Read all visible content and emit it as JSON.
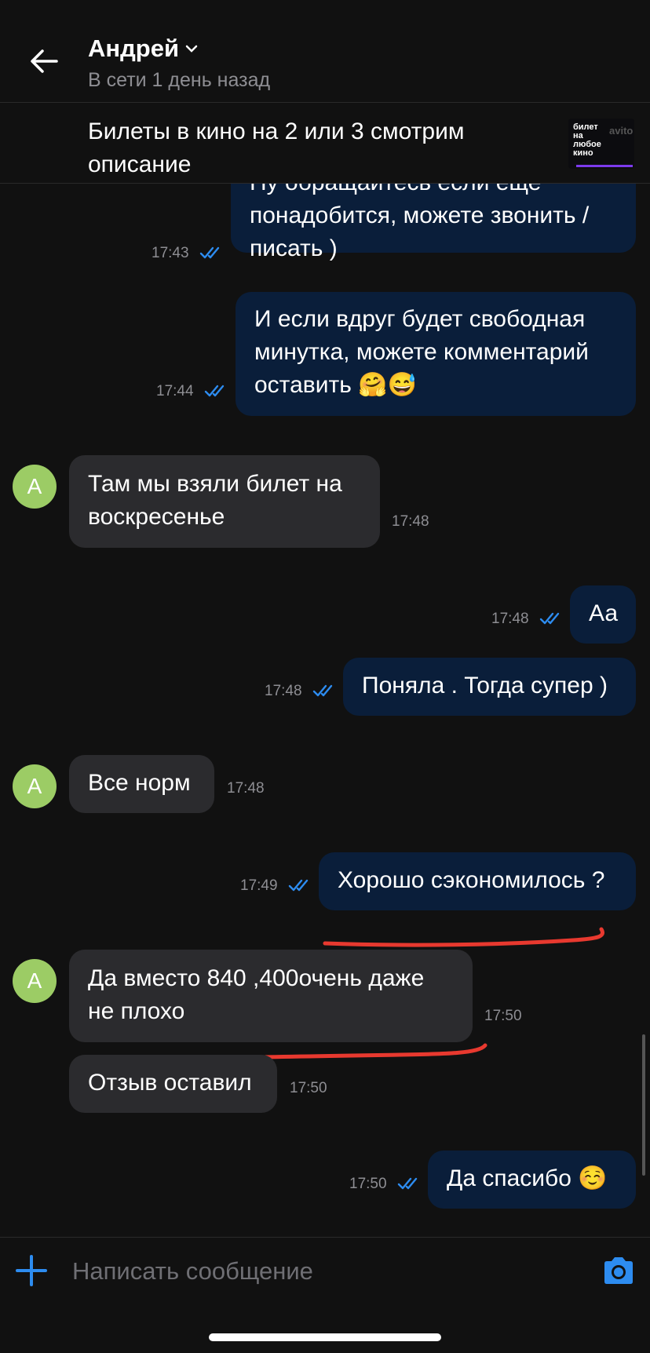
{
  "header": {
    "name": "Андрей",
    "status": "В сети 1 день назад"
  },
  "listing": {
    "title": "Билеты в кино на 2 или 3 смотрим описание",
    "thumb_text": "билет на любое кино",
    "thumb_logo": "avito"
  },
  "messages": [
    {
      "dir": "out",
      "text": "Ну обращайтесь если еще понадобится, можете звонить / писать )",
      "time": "17:43",
      "read": true
    },
    {
      "dir": "out",
      "text": "И если вдруг будет свободная минутка, можете комментарий оставить 🤗😅",
      "time": "17:44",
      "read": true
    },
    {
      "dir": "in",
      "avatar": "А",
      "text": "Там мы взяли билет на воскресенье",
      "time": "17:48"
    },
    {
      "dir": "out",
      "text": "Аа",
      "time": "17:48",
      "read": true
    },
    {
      "dir": "out",
      "text": "Поняла . Тогда супер )",
      "time": "17:48",
      "read": true
    },
    {
      "dir": "in",
      "avatar": "А",
      "text": "Все норм",
      "time": "17:48"
    },
    {
      "dir": "out",
      "text": "Хорошо сэкономилось ?",
      "time": "17:49",
      "read": true
    },
    {
      "dir": "in",
      "avatar": "А",
      "text": "Да вместо 840 ,400очень даже не плохо",
      "time": "17:50"
    },
    {
      "dir": "in",
      "text": "Отзыв оставил",
      "time": "17:50"
    },
    {
      "dir": "out",
      "text": "Да спасибо ☺️",
      "time": "17:50",
      "read": true
    }
  ],
  "composer": {
    "placeholder": "Написать сообщение"
  },
  "colors": {
    "background": "#111111",
    "outgoing_bubble": "#0a1e3a",
    "incoming_bubble": "#2b2b2e",
    "accent": "#2d8cf0",
    "avatar": "#9ccc65",
    "annotation": "#e8392f"
  },
  "icons": [
    "arrow-left-icon",
    "chevron-down-icon",
    "double-check-icon",
    "plus-icon",
    "camera-icon"
  ]
}
